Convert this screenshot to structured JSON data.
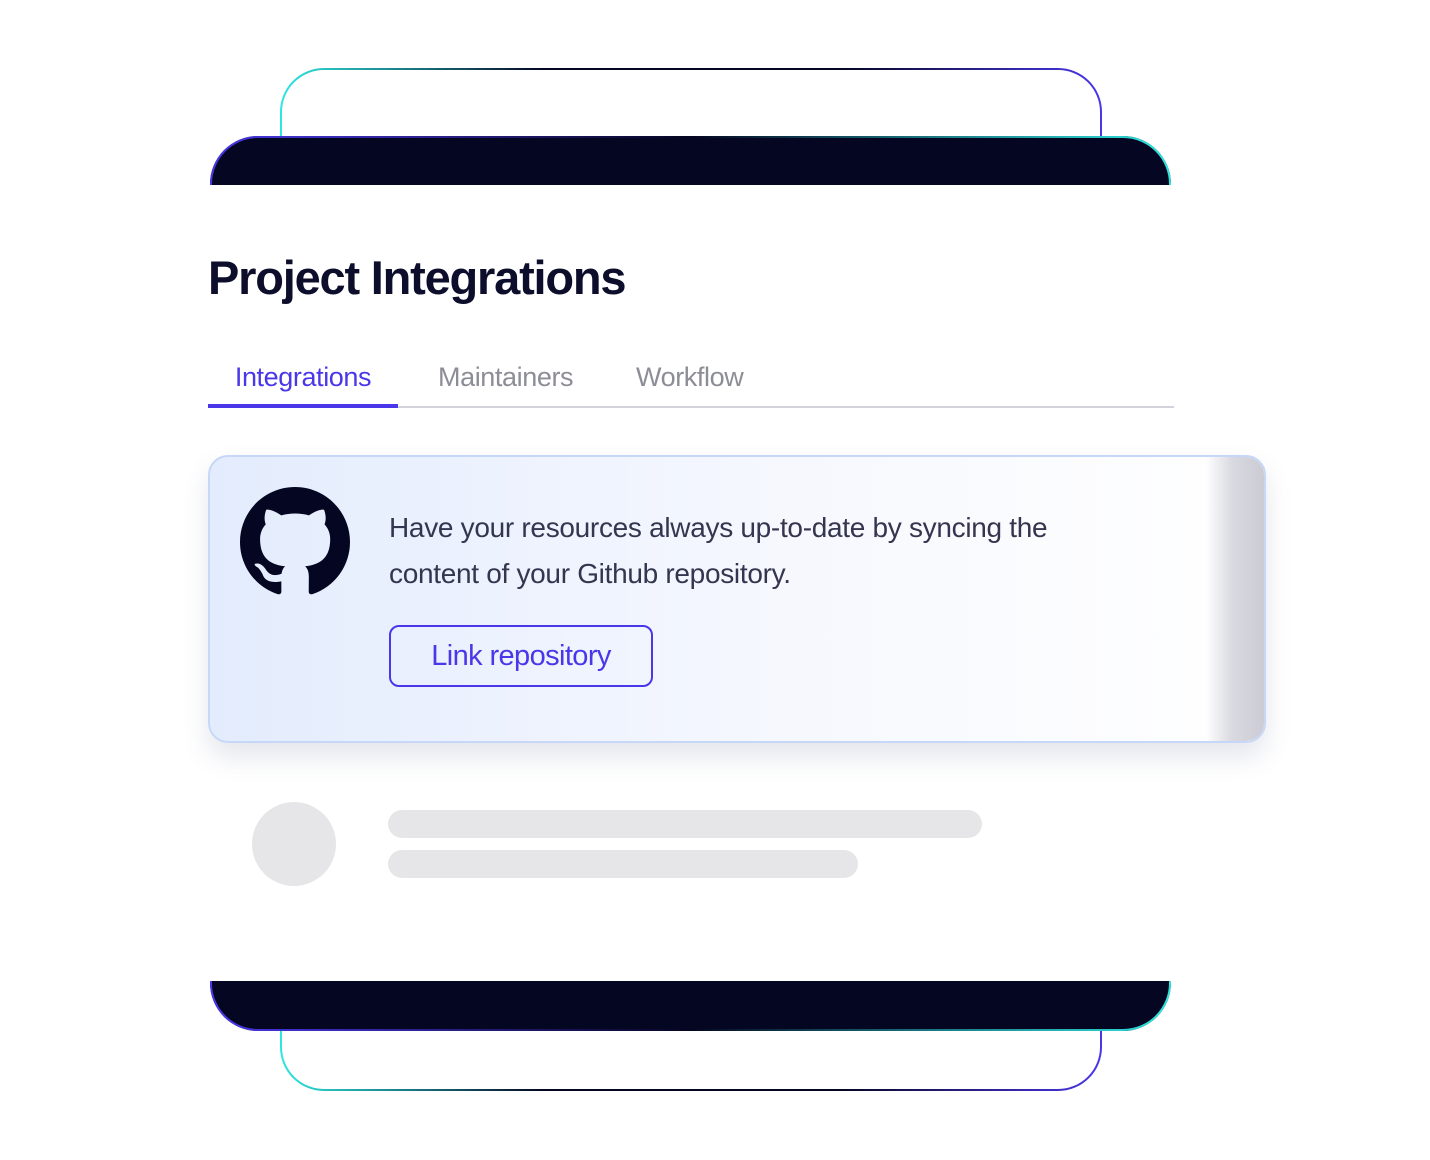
{
  "page": {
    "title": "Project Integrations"
  },
  "tabs": [
    {
      "label": "Integrations",
      "active": true
    },
    {
      "label": "Maintainers",
      "active": false
    },
    {
      "label": "Workflow",
      "active": false
    }
  ],
  "integration_card": {
    "icon": "github-icon",
    "description": "Have your resources always up-to-date by syncing the content of your Github repository.",
    "button_label": "Link repository"
  },
  "colors": {
    "accent": "#4a37ea",
    "dark_bar": "#050621",
    "outline_cyan": "#2ee6e0",
    "outline_indigo": "#4a37ea",
    "skeleton": "#e6e6e8"
  }
}
